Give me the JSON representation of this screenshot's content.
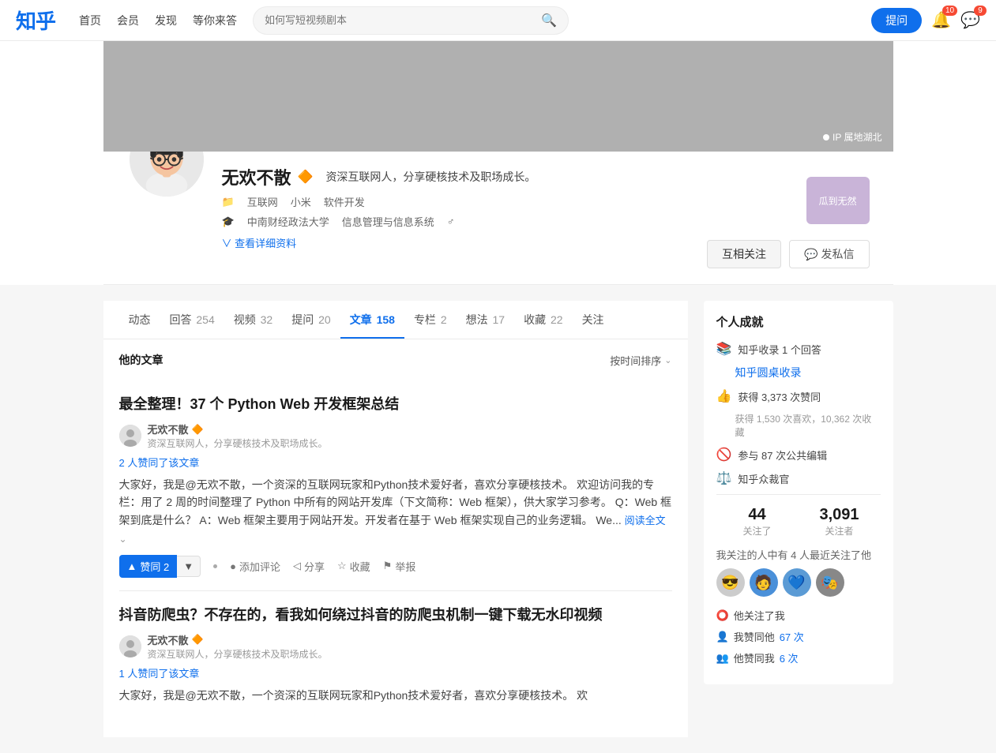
{
  "header": {
    "logo": "知乎",
    "nav": [
      "首页",
      "会员",
      "发现",
      "等你来答"
    ],
    "search_placeholder": "如何写短视频剧本",
    "btn_ask": "提问",
    "notification_count": "10",
    "message_count": "9"
  },
  "profile": {
    "name": "无欢不散",
    "badge": "🔶",
    "description": "资深互联网人，分享硬核技术及职场成长。",
    "tags": [
      "互联网",
      "小米",
      "软件开发"
    ],
    "education": "中南财经政法大学",
    "major": "信息管理与信息系统",
    "ip_location": "IP 属地湖北",
    "btn_follow": "互相关注",
    "btn_message": "发私信",
    "view_profile": "查看详细资料",
    "side_image_text": "瓜到无然"
  },
  "tabs": [
    {
      "label": "动态",
      "count": ""
    },
    {
      "label": "回答",
      "count": "254"
    },
    {
      "label": "视频",
      "count": "32"
    },
    {
      "label": "提问",
      "count": "20"
    },
    {
      "label": "文章",
      "count": "158",
      "active": true
    },
    {
      "label": "专栏",
      "count": "2"
    },
    {
      "label": "想法",
      "count": "17"
    },
    {
      "label": "收藏",
      "count": "22"
    },
    {
      "label": "关注",
      "count": ""
    }
  ],
  "articles": {
    "section_title": "他的文章",
    "sort_label": "按时间排序",
    "items": [
      {
        "title": "最全整理！37 个 Python Web 开发框架总结",
        "author": "无欢不散",
        "author_desc": "资深互联网人，分享硬核技术及职场成长。",
        "agree_text": "2 人赞同了该文章",
        "excerpt": "大家好，我是@无欢不散，一个资深的互联网玩家和Python技术爱好者，喜欢分享硬核技术。 欢迎访问我的专栏：用了 2 周的时间整理了 Python 中所有的网站开发库（下文简称：Web 框架），供大家学习参考。 Q：Web 框架到底是什么？ A：Web 框架主要用于网站开发。开发者在基于 Web 框架实现自己的业务逻辑。 We...",
        "read_more": "阅读全文",
        "vote_count": "赞同 2",
        "actions": [
          "添加评论",
          "分享",
          "收藏",
          "举报"
        ]
      },
      {
        "title": "抖音防爬虫？不存在的，看我如何绕过抖音的防爬虫机制一键下载无水印视频",
        "author": "无欢不散",
        "author_desc": "资深互联网人，分享硬核技术及职场成长。",
        "agree_text": "1 人赞同了该文章",
        "excerpt": "大家好，我是@无欢不散，一个资深的互联网玩家和Python技术爱好者，喜欢分享硬核技术。 欢",
        "read_more": "",
        "vote_count": "",
        "actions": []
      }
    ]
  },
  "sidebar": {
    "achievement_title": "个人成就",
    "achievements": [
      {
        "icon": "📚",
        "text": "知乎收录 1 个回答",
        "link": "知乎圆桌收录"
      },
      {
        "icon": "👍",
        "text": "获得 3,373 次赞同",
        "sub": "获得 1,530 次喜欢，10,362 次收藏"
      },
      {
        "icon": "🚫",
        "text": "参与 87 次公共编辑"
      },
      {
        "icon": "⚖️",
        "text": "知乎众裁官"
      }
    ],
    "following_count": "44",
    "following_label": "关注了",
    "followers_count": "3,091",
    "followers_label": "关注者",
    "mutual_follow_text": "我关注的人中有 4 人最近关注了他",
    "mutual_avatars": [
      "😎",
      "🧑",
      "💙",
      "🎭"
    ],
    "links": [
      {
        "icon": "⭕",
        "text": "他关注了我"
      },
      {
        "icon": "👤",
        "text": "我赞同他",
        "val": "67 次"
      },
      {
        "icon": "👥",
        "text": "他赞同我",
        "val": "6 次"
      }
    ]
  }
}
